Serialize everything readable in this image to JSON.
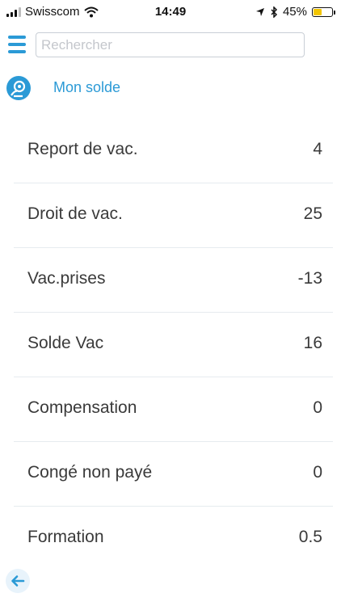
{
  "status_bar": {
    "carrier": "Swisscom",
    "time": "14:49",
    "battery_percent": "45%",
    "battery_level": 0.45,
    "battery_color": "#f2c500"
  },
  "header": {
    "menu_icon": "hamburger-icon",
    "search_placeholder": "Rechercher"
  },
  "section": {
    "icon": "account-balance-icon",
    "title": "Mon solde"
  },
  "balances": [
    {
      "label": "Report de vac.",
      "value": "4"
    },
    {
      "label": "Droit de vac.",
      "value": "25"
    },
    {
      "label": "Vac.prises",
      "value": "-13"
    },
    {
      "label": "Solde Vac",
      "value": "16"
    },
    {
      "label": "Compensation",
      "value": "0"
    },
    {
      "label": "Congé non payé",
      "value": "0"
    },
    {
      "label": "Formation",
      "value": "0.5"
    }
  ],
  "footer": {
    "back_icon": "arrow-left-icon"
  },
  "colors": {
    "accent": "#2b9ad6",
    "divider": "#e6ebef",
    "text": "#3a3a3a"
  }
}
